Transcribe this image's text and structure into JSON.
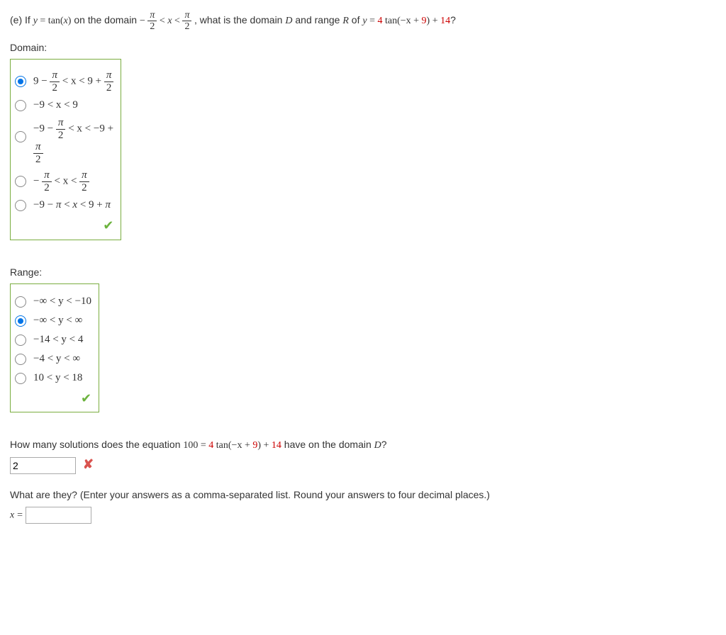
{
  "question": {
    "part": "(e)",
    "prefix": "If ",
    "eq1": "y = tan(x)",
    "mid1": " on the domain ",
    "mid2": ", what is the domain ",
    "D": "D",
    "mid3": " and range ",
    "R": "R",
    "mid4": " of ",
    "eq2_a": "y = ",
    "eq2_b": "4",
    "eq2_c": " tan(−x + ",
    "eq2_d": "9",
    "eq2_e": ") + ",
    "eq2_f": "14",
    "eq2_g": "?"
  },
  "domain_label": "Domain:",
  "domain_choices": {
    "c1a": "9 − ",
    "c1b": " < x < 9 + ",
    "c2": "−9 < x < 9",
    "c3a": "−9 − ",
    "c3b": " < x < −9 +",
    "c4a": "− ",
    "c4b": " < x < ",
    "c5": "−9 − π < x < 9 + π"
  },
  "range_label": "Range:",
  "range_choices": {
    "r1": "−∞ < y < −10",
    "r2": "−∞ < y < ∞",
    "r3": "−14 < y < 4",
    "r4": "−4 < y < ∞",
    "r5": "10 < y < 18"
  },
  "solutions_q": {
    "a": "How many solutions does the equation ",
    "b": "100 = ",
    "c": "4",
    "d": " tan(−x + ",
    "e": "9",
    "f": ") + ",
    "g": "14",
    "h": " have on the domain ",
    "i": "D",
    "j": "?"
  },
  "solutions_input": "2",
  "what_q": "What are they? (Enter your answers as a comma-separated list. Round your answers to four decimal places.)",
  "x_eq": "x =",
  "pi": "π",
  "two": "2"
}
